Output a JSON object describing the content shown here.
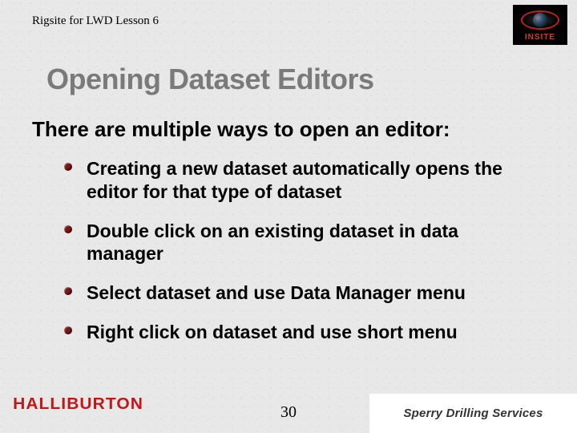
{
  "header": {
    "lesson_label": "Rigsite for LWD Lesson 6",
    "logo_text": "INSITE"
  },
  "slide": {
    "title": "Opening Dataset Editors",
    "intro": "There are multiple ways to open an editor:",
    "bullets": [
      "Creating a new dataset automatically opens the editor for that type of dataset",
      "Double click on an existing dataset in data manager",
      "Select dataset and use Data Manager menu",
      "Right click on dataset and use short menu"
    ]
  },
  "footer": {
    "company_left": "HALLIBURTON",
    "page_number": "30",
    "company_right": "Sperry Drilling Services"
  }
}
